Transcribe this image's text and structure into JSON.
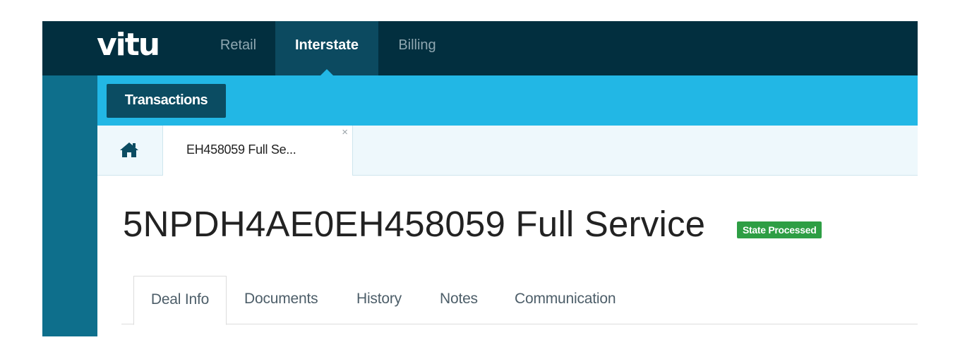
{
  "app": {
    "logo": "vitu"
  },
  "topnav": {
    "items": [
      {
        "label": "Retail",
        "active": false
      },
      {
        "label": "Interstate",
        "active": true
      },
      {
        "label": "Billing",
        "active": false
      }
    ]
  },
  "subnav": {
    "transactions_label": "Transactions"
  },
  "tabstrip": {
    "home_icon": "home-icon",
    "open_tab_label": "EH458059 Full Se...",
    "close_glyph": "×"
  },
  "page": {
    "title": "5NPDH4AE0EH458059 Full Service",
    "status_badge": "State Processed"
  },
  "content_tabs": [
    {
      "label": "Deal Info",
      "active": true
    },
    {
      "label": "Documents",
      "active": false
    },
    {
      "label": "History",
      "active": false
    },
    {
      "label": "Notes",
      "active": false
    },
    {
      "label": "Communication",
      "active": false
    }
  ],
  "colors": {
    "topnav_bg": "#022f3f",
    "topnav_active_bg": "#0c4a60",
    "subnav_bg": "#22b7e5",
    "sidebar_bg": "#0e6f8c",
    "badge_green": "#2e9e44"
  }
}
